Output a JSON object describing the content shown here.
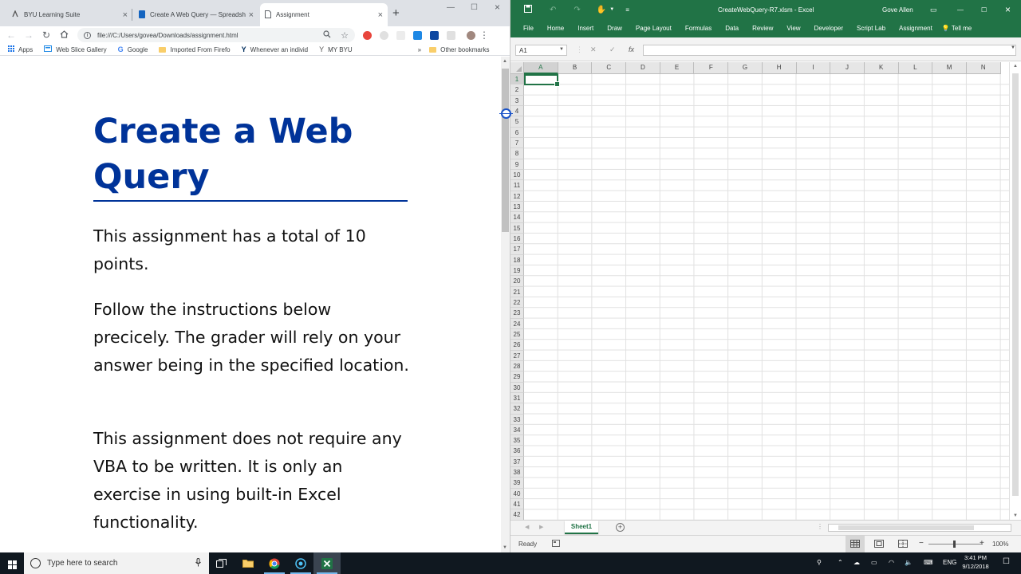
{
  "browser": {
    "tabs": [
      {
        "title": "BYU Learning Suite",
        "icon": "learning-suite-icon"
      },
      {
        "title": "Create A Web Query — Spreadsheet",
        "icon": "document-icon"
      },
      {
        "title": "Assignment",
        "icon": "page-icon",
        "active": true
      }
    ],
    "new_tab": "+",
    "url": "file:///C:/Users/govea/Downloads/assignment.html",
    "bookmarks": [
      {
        "label": "Apps",
        "icon": "apps-icon"
      },
      {
        "label": "Web Slice Gallery",
        "icon": "web-slice-icon"
      },
      {
        "label": "Google",
        "icon": "google-icon"
      },
      {
        "label": "Imported From Firefo",
        "icon": "folder-icon"
      },
      {
        "label": "Whenever an individ",
        "icon": "byu-y-icon"
      },
      {
        "label": "MY BYU",
        "icon": "byu-y-icon"
      }
    ],
    "more_bookmarks": "»",
    "other_bookmarks": "Other bookmarks",
    "page": {
      "title": "Create a Web Query",
      "paragraphs": [
        "This assignment has a total of 10 points.",
        "Follow the instructions below precicely. The grader will rely on your answer being in the specified location.",
        "This assignment does not require any VBA to be written. It is only an exercise in using built-in Excel functionality."
      ]
    }
  },
  "excel": {
    "file_title": "CreateWebQuery-R7.xlsm  -  Excel",
    "user": "Gove Allen",
    "ribbon_tabs": [
      "File",
      "Home",
      "Insert",
      "Draw",
      "Page Layout",
      "Formulas",
      "Data",
      "Review",
      "View",
      "Developer",
      "Script Lab",
      "Assignment"
    ],
    "tell_me": "Tell me",
    "name_box": "A1",
    "formula": "",
    "fx": "fx",
    "columns": [
      "A",
      "B",
      "C",
      "D",
      "E",
      "F",
      "G",
      "H",
      "I",
      "J",
      "K",
      "L",
      "M",
      "N"
    ],
    "rows": [
      "1",
      "2",
      "3",
      "4",
      "5",
      "6",
      "7",
      "8",
      "9",
      "10",
      "11",
      "12",
      "13",
      "14",
      "15",
      "16",
      "17",
      "18",
      "19",
      "20",
      "21",
      "22",
      "23",
      "24",
      "25",
      "26",
      "27",
      "28",
      "29",
      "30",
      "31",
      "32",
      "33",
      "34",
      "35",
      "36",
      "37",
      "38",
      "39",
      "40",
      "41",
      "42"
    ],
    "sheet_tab": "Sheet1",
    "status": "Ready",
    "zoom": "100%",
    "accent_color": "#217346"
  },
  "taskbar": {
    "search_placeholder": "Type here to search",
    "language": "ENG",
    "time": "3:41 PM",
    "date": "9/12/2018"
  }
}
